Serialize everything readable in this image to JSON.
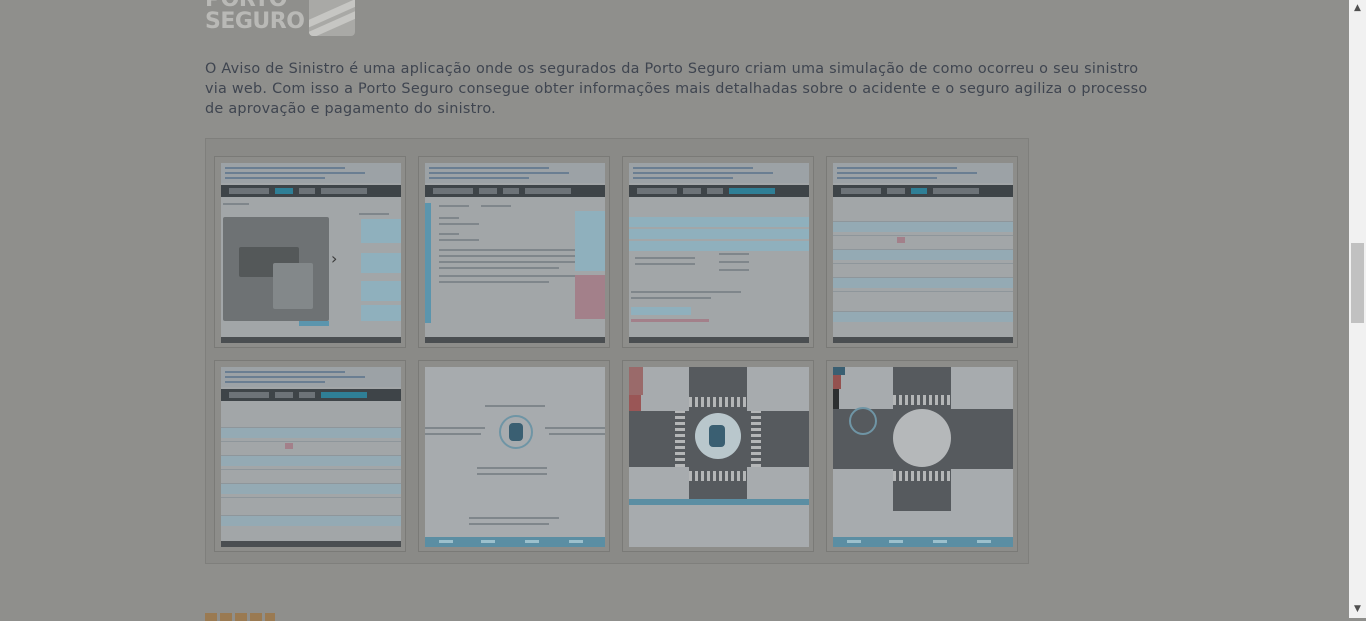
{
  "brand": {
    "line1": "PORTO",
    "line2": "SEGURO"
  },
  "intro_text": "O Aviso de Sinistro é uma aplicação onde os segurados da Porto Seguro criam uma simulação de como ocorreu o seu sinistro via web. Com isso a Porto Seguro consegue obter informações mais detalhadas sobre o acidente e o seguro agiliza o processo de aprovação e pagamento do sinistro.",
  "gallery": {
    "thumbnails": [
      {
        "kind": "app-screenshot",
        "content": "photo"
      },
      {
        "kind": "app-screenshot",
        "content": "text"
      },
      {
        "kind": "app-screenshot",
        "content": "table"
      },
      {
        "kind": "app-screenshot",
        "content": "parts-list"
      },
      {
        "kind": "app-screenshot",
        "content": "parts-list"
      },
      {
        "kind": "simulation",
        "content": "instructions"
      },
      {
        "kind": "simulation",
        "content": "crossroad"
      },
      {
        "kind": "simulation",
        "content": "roundabout"
      }
    ]
  },
  "colors": {
    "overlay_bg": "#8f8f8c",
    "intro_text": "#3f4550",
    "accent_blue": "#5b95ad"
  },
  "scrollbar": {
    "up_icon": "triangle-up-icon",
    "down_icon": "triangle-down-icon"
  }
}
